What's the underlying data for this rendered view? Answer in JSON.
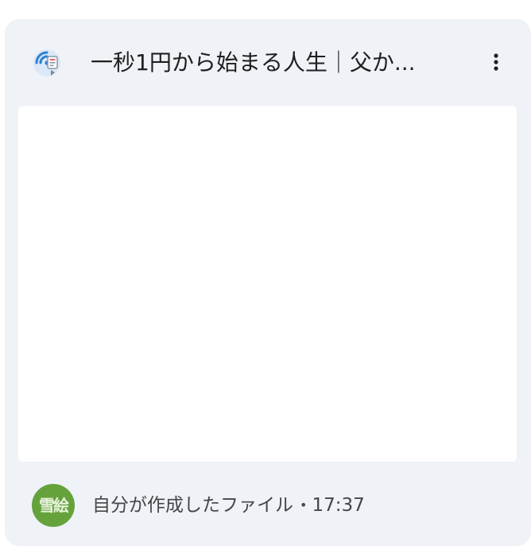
{
  "file": {
    "title": "一秒1円から始まる人生｜父か...",
    "icon": "wifi-document-icon"
  },
  "menu": {
    "icon": "more-vert-icon"
  },
  "footer": {
    "avatar_text": "雪絵",
    "avatar_color": "#66a23c",
    "owner_text": "自分が作成したファイル",
    "separator": "•",
    "time": "17:37"
  }
}
